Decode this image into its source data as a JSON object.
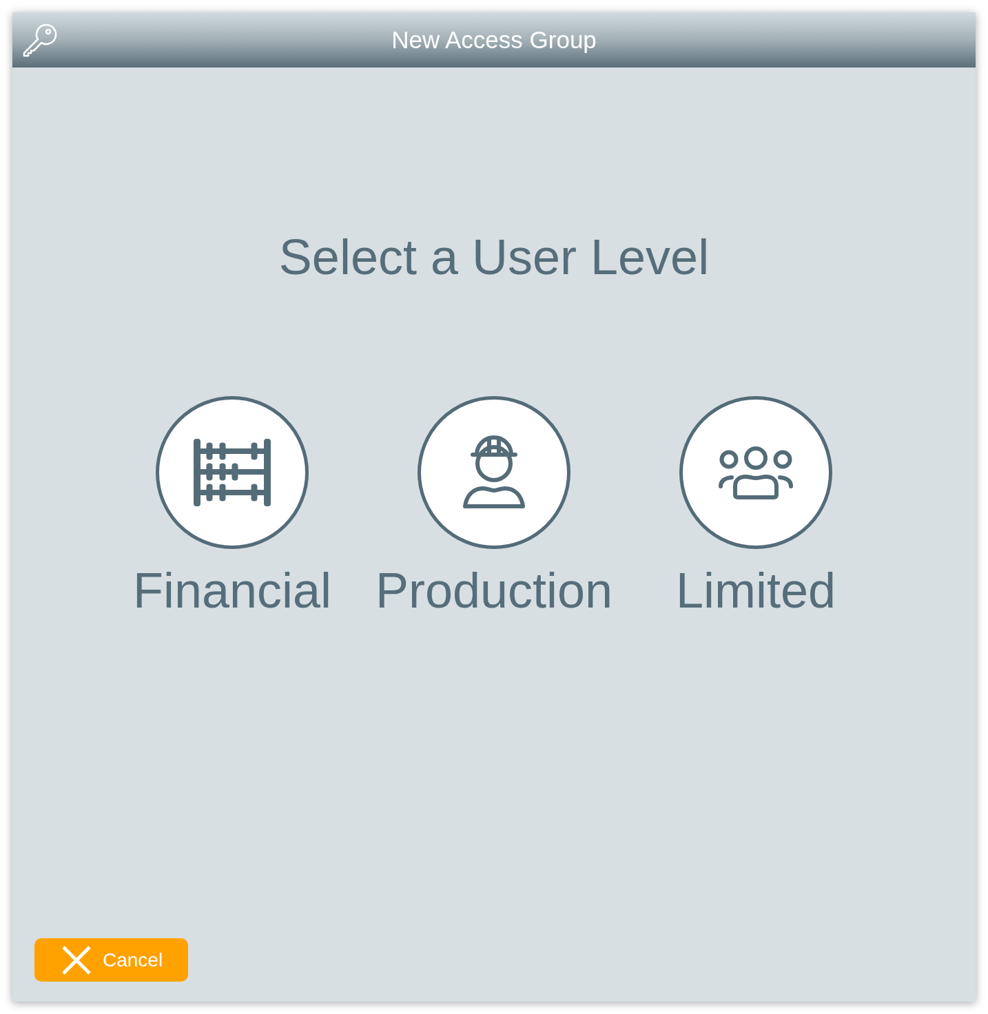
{
  "window": {
    "title": "New Access Group"
  },
  "heading": "Select a User Level",
  "levels": [
    {
      "label": "Financial",
      "kind": "abacus",
      "selected": false
    },
    {
      "label": "Production",
      "kind": "worker",
      "selected": false
    },
    {
      "label": "Limited",
      "kind": "group",
      "selected": false
    }
  ],
  "cancel_button": {
    "label": "Cancel"
  }
}
